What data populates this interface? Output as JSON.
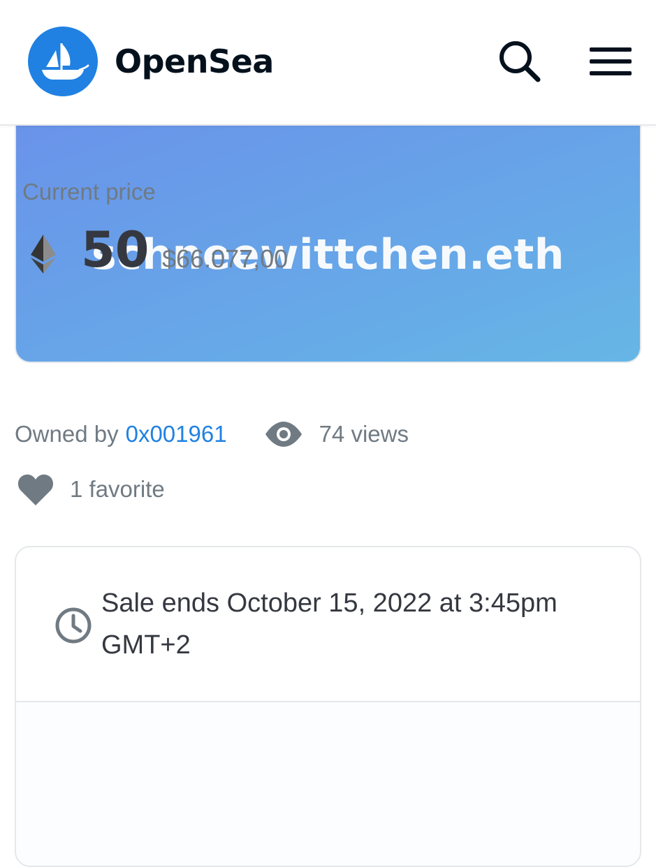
{
  "header": {
    "brand_name": "OpenSea",
    "logo_icon": "opensea-ship-icon",
    "search_icon": "search-icon",
    "menu_icon": "hamburger-menu-icon",
    "brand_color": "#2081e2"
  },
  "banner": {
    "title": "schneewittchen.eth",
    "gradient_start": "#6a92ea",
    "gradient_end": "#66b6e6"
  },
  "meta": {
    "owned_by_label": "Owned by",
    "owner": "0x001961",
    "views_icon": "eye-icon",
    "views": "74 views",
    "favorite_icon": "heart-icon",
    "favorites": "1 favorite"
  },
  "sale": {
    "clock_icon": "clock-icon",
    "ends_text": "Sale ends October 15, 2022 at 3:45pm GMT+2"
  },
  "price": {
    "label": "Current price",
    "currency_icon": "ethereum-icon",
    "amount": "50",
    "usd": "$66.077,00"
  }
}
